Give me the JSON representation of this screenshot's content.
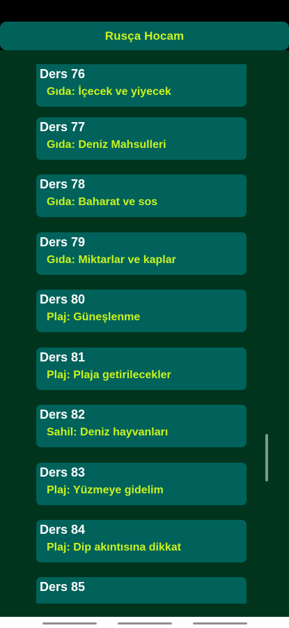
{
  "app": {
    "title": "Rusça Hocam"
  },
  "colors": {
    "accent": "#c9f21f",
    "card_background": "#00625b",
    "list_background": "#00341d"
  },
  "lessons": [
    {
      "number": "Ders 76",
      "topic": "Gıda: İçecek ve yiyecek"
    },
    {
      "number": "Ders 77",
      "topic": "Gıda: Deniz Mahsulleri"
    },
    {
      "number": "Ders 78",
      "topic": "Gıda: Baharat ve sos"
    },
    {
      "number": "Ders 79",
      "topic": "Gıda: Miktarlar ve kaplar"
    },
    {
      "number": "Ders 80",
      "topic": "Plaj: Güneşlenme"
    },
    {
      "number": "Ders 81",
      "topic": "Plaj: Plaja getirilecekler"
    },
    {
      "number": "Ders 82",
      "topic": "Sahil: Deniz hayvanları"
    },
    {
      "number": "Ders 83",
      "topic": "Plaj: Yüzmeye gidelim"
    },
    {
      "number": "Ders 84",
      "topic": "Plaj: Dip akıntısına dikkat"
    },
    {
      "number": "Ders 85",
      "topic": ""
    }
  ]
}
